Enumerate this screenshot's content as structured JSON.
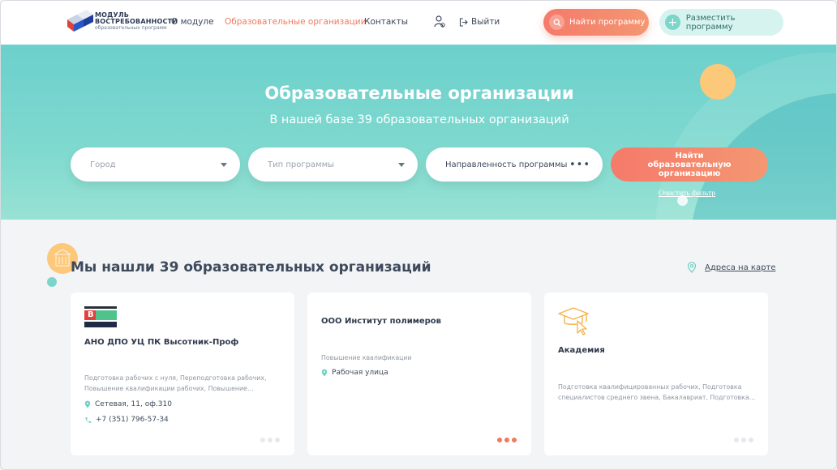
{
  "header": {
    "logo": {
      "line1": "МОДУЛЬ",
      "line2": "ВОСТРЕБОВАННОСТИ",
      "line3": "образовательных программ"
    },
    "nav": [
      {
        "label": "О модуле",
        "active": false
      },
      {
        "label": "Образовательные организации",
        "active": true
      },
      {
        "label": "Контакты",
        "active": false
      }
    ],
    "logout_label": "Выйти",
    "find_program_label": "Найти программу",
    "place_program_label": "Разместить программу"
  },
  "hero": {
    "title": "Образовательные организации",
    "subtitle": "В нашей базе 39 образовательных организаций",
    "filters": {
      "city_placeholder": "Город",
      "program_type_placeholder": "Тип программы",
      "direction_label": "Направленность программы"
    },
    "search_button_label": "Найти образовательную организацию",
    "clear_filter_label": "Очистить фильтр"
  },
  "results": {
    "title": "Мы нашли 39 образовательных организаций",
    "map_link_label": "Адреса на карте",
    "cards": [
      {
        "name": "АНО ДПО УЦ ПК Высотник-Проф",
        "logo_text": "В",
        "description": "Подготовка рабочих с нуля, Переподготовка рабочих, Повышение квалификации рабочих, Повышение…",
        "address": "Сетевая, 11, оф.310",
        "phone": "+7 (351) 796-57-34"
      },
      {
        "name": "ООО Институт полимеров",
        "description": "Повышение квалификации",
        "address": "Рабочая улица"
      },
      {
        "name": "Академия",
        "description": "Подготовка квалифицированных рабочих, Подготовка специалистов среднего звена, Бакалавриат, Подготовка…"
      }
    ]
  },
  "colors": {
    "accent": "#f07a5c",
    "teal": "#6cd0cc",
    "yellow": "#fcc87a",
    "text": "#3d4a5c"
  }
}
